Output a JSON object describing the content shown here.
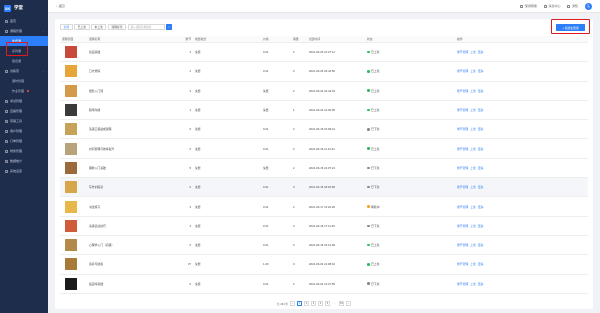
{
  "brand": {
    "logo": "XK",
    "name": "学堂"
  },
  "sidebar": {
    "items": [
      {
        "label": "首页",
        "type": "top"
      },
      {
        "label": "课程管理",
        "type": "top-open"
      },
      {
        "label": "免费课",
        "type": "sub-active"
      },
      {
        "label": "系列课",
        "type": "sub"
      },
      {
        "label": "组合课",
        "type": "sub"
      },
      {
        "label": "训练营",
        "type": "top-open"
      },
      {
        "label": "课时管理",
        "type": "sub"
      },
      {
        "label": "作业管理",
        "type": "sub-dot"
      },
      {
        "label": "考试管理",
        "type": "top"
      },
      {
        "label": "直播管理",
        "type": "top"
      },
      {
        "label": "营销工具",
        "type": "top"
      },
      {
        "label": "用户管理",
        "type": "top"
      },
      {
        "label": "订单管理",
        "type": "top"
      },
      {
        "label": "财务管理",
        "type": "top"
      },
      {
        "label": "数据统计",
        "type": "top"
      },
      {
        "label": "系统设置",
        "type": "top"
      }
    ]
  },
  "topbar": {
    "back_label": "返回",
    "items": [
      {
        "icon": "document-icon",
        "label": "使用帮助"
      },
      {
        "icon": "bell-icon",
        "label": "消息中心"
      },
      {
        "icon": "mail-icon",
        "label": "通知"
      }
    ],
    "avatar": "头"
  },
  "filters": {
    "chips": [
      "全部",
      "已上架",
      "未上架",
      "课程标签"
    ],
    "search_placeholder": "输入课程名称搜索",
    "search_btn": "⌕"
  },
  "add_button": "+ 新建免费课",
  "table": {
    "headers": [
      "课程封面",
      "课程名称",
      "章节",
      "收费模式",
      "价格",
      "销量",
      "创建时间",
      "状态",
      "操作"
    ],
    "rows": [
      {
        "color": "#c94a3a",
        "title": "绘画基础",
        "chap": "4",
        "mode": "免费",
        "price": "0.01",
        "sales": "2",
        "time": "2021-06-25 21:27:11",
        "status": "已上架",
        "status_color": "#2bbf5a",
        "ops": [
          "章节管理",
          "上架",
          "更多"
        ]
      },
      {
        "color": "#e6a63a",
        "title": "口才修炼",
        "chap": "2",
        "mode": "免费",
        "price": "0.01",
        "sales": "0",
        "time": "2021-06-25 19:44:50",
        "status": "已上架",
        "status_color": "#2bbf5a",
        "ops": [
          "章节管理",
          "上架",
          "更多"
        ]
      },
      {
        "color": "#d39a4a",
        "title": "摄影入门课",
        "chap": "3",
        "mode": "免费",
        "price": "免费",
        "sales": "2",
        "time": "2021-06-24 16:44:33",
        "status": "已上架",
        "status_color": "#2bbf5a",
        "ops": [
          "章节管理",
          "上架",
          "更多"
        ]
      },
      {
        "color": "#3a3a3a",
        "title": "职场沟通",
        "chap": "1",
        "mode": "免费",
        "price": "免费",
        "sales": "1",
        "time": "2021-06-24 14:30:05",
        "status": "已上架",
        "status_color": "#2bbf5a",
        "ops": [
          "章节管理",
          "上架",
          "更多"
        ]
      },
      {
        "color": "#c9a25a",
        "title": "英语口语速成课程",
        "chap": "6",
        "mode": "免费",
        "price": "0.01",
        "sales": "2",
        "time": "2021-06-15 10:09:12",
        "status": "已下架",
        "status_color": "#888888",
        "ops": [
          "章节管理",
          "上架",
          "更多"
        ]
      },
      {
        "color": "#b8a37a",
        "title": "时间管理与效率提升",
        "chap": "6",
        "mode": "免费",
        "price": "0.01",
        "sales": "2",
        "time": "2021-06-15 11:12:44",
        "status": "已上架",
        "status_color": "#2bbf5a",
        "ops": [
          "章节管理",
          "上架",
          "更多"
        ]
      },
      {
        "color": "#9a6a3a",
        "title": "理财入门基础",
        "chap": "5",
        "mode": "免费",
        "price": "免费",
        "sales": "2",
        "time": "2021-06-15 21:07:21",
        "status": "已下架",
        "status_color": "#888888",
        "ops": [
          "章节管理",
          "上架",
          "更多"
        ]
      },
      {
        "color": "#d7a54a",
        "title": "写作训练营",
        "chap": "6",
        "mode": "免费",
        "price": "0.01",
        "sales": "3",
        "time": "2021-06-15 18:18:06",
        "status": "已下架",
        "status_color": "#888888",
        "ops": [
          "章节管理",
          "上架",
          "更多"
        ],
        "hl": true
      },
      {
        "color": "#e8b74a",
        "title": "书法练习",
        "chap": "3",
        "mode": "免费",
        "price": "0.01",
        "sales": "2",
        "time": "2021-06-17 12:22:26",
        "status": "审核中",
        "status_color": "#f5a623",
        "ops": [
          "章节管理",
          "上架",
          "更多"
        ]
      },
      {
        "color": "#cf5b3a",
        "title": "演讲表达技巧",
        "chap": "4",
        "mode": "免费",
        "price": "0.01",
        "sales": "0",
        "time": "2021-06-16 17:11:45",
        "status": "已下架",
        "status_color": "#888888",
        "ops": [
          "章节管理",
          "上架",
          "更多"
        ]
      },
      {
        "color": "#b48a4a",
        "title": "心理学入门（初级）",
        "chap": "6",
        "mode": "免费",
        "price": "0.01",
        "sales": "0",
        "time": "2021-06-16 15:13:48",
        "status": "已上架",
        "status_color": "#2bbf5a",
        "ops": [
          "章节管理",
          "上架",
          "更多"
        ]
      },
      {
        "color": "#a87a3a",
        "title": "营养与健康",
        "chap": "37",
        "mode": "免费",
        "price": "1.00",
        "sales": "0",
        "time": "2021-06-04 21:08:10",
        "status": "已上架",
        "status_color": "#2bbf5a",
        "ops": [
          "章节管理",
          "上架",
          "更多"
        ]
      },
      {
        "color": "#1a1a1a",
        "title": "插画零基础",
        "chap": "6",
        "mode": "免费",
        "price": "0.01",
        "sales": "2",
        "time": "2021-06-04 14:27:55",
        "status": "已下架",
        "status_color": "#888888",
        "ops": [
          "章节管理",
          "上架",
          "更多"
        ]
      }
    ]
  },
  "pager": {
    "total": "共 263 条",
    "pages": [
      "1",
      "2",
      "3",
      "4",
      "5",
      "...",
      "53"
    ],
    "prev": "‹",
    "next": "›"
  },
  "colors": {
    "accent": "#2d7ff9",
    "sidebar": "#1f2d4d",
    "highlight": "#e0191f"
  }
}
